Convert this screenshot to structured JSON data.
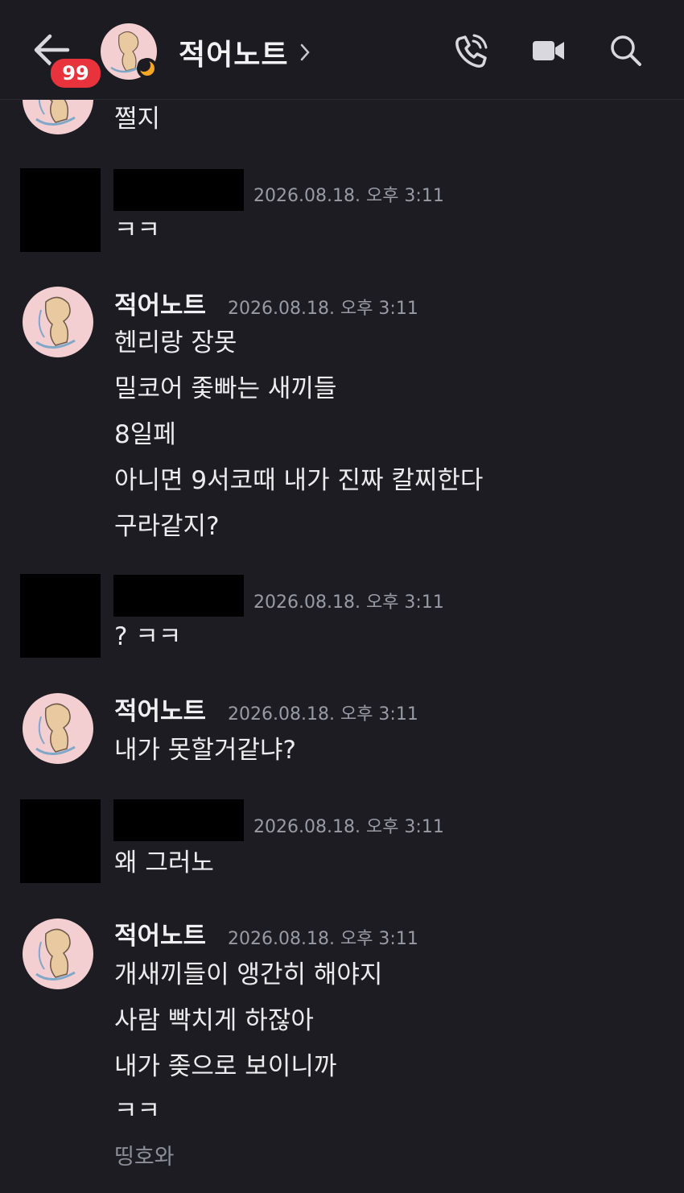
{
  "header": {
    "title": "적어노트",
    "unread_count": "99",
    "icons": [
      "back-arrow-icon",
      "chevron-right-icon",
      "phone-call-icon",
      "video-call-icon",
      "search-icon"
    ]
  },
  "messages": [
    {
      "sender": "",
      "time": "",
      "lines": [
        "쩔지"
      ]
    },
    {
      "sender": "",
      "time": "2026.08.18. 오후 3:11",
      "lines": [
        "ㅋㅋ"
      ],
      "redacted": true
    },
    {
      "sender": "적어노트",
      "time": "2026.08.18. 오후 3:11",
      "lines": [
        "헨리랑 장못",
        "밀코어 좇빠는 새끼들",
        "8일페",
        "아니면 9서코때 내가 진짜 칼찌한다",
        "구라같지?"
      ]
    },
    {
      "sender": "",
      "time": "2026.08.18. 오후 3:11",
      "lines": [
        "? ㅋㅋ"
      ],
      "redacted": true
    },
    {
      "sender": "적어노트",
      "time": "2026.08.18. 오후 3:11",
      "lines": [
        "내가 못할거같냐?"
      ]
    },
    {
      "sender": "",
      "time": "2026.08.18. 오후 3:11",
      "lines": [
        "왜 그러노"
      ],
      "redacted": true
    },
    {
      "sender": "적어노트",
      "time": "2026.08.18. 오후 3:11",
      "lines": [
        "개새끼들이 앵간히 해야지",
        "사람 빡치게 하잖아",
        "내가 좆으로 보이니까",
        "ㅋㅋ"
      ]
    }
  ],
  "typing": "띵호와",
  "colors": {
    "background": "#1c1c22",
    "badge": "#e8323c",
    "avatar_bg": "#f4cfd2",
    "moon": "#f5a623"
  }
}
